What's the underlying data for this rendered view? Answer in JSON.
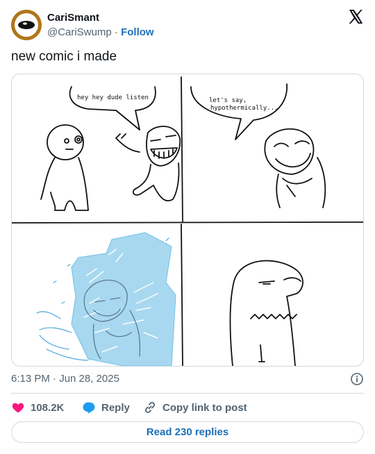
{
  "author": {
    "display_name": "CariSmant",
    "handle": "@CariSwump",
    "separator": "·",
    "follow_label": "Follow"
  },
  "tweet": {
    "text": "new comic i made"
  },
  "comic": {
    "panel1_speech": "hey hey dude  listen",
    "panel2_speech_line1": "let's say,",
    "panel2_speech_line2": "hypothermically..."
  },
  "meta": {
    "timestamp": "6:13 PM · Jun 28, 2025"
  },
  "actions": {
    "likes_count": "108.2K",
    "reply_label": "Reply",
    "copy_label": "Copy link to post"
  },
  "footer": {
    "read_replies_label": "Read 230 replies"
  },
  "colors": {
    "like_pink": "#f91880",
    "reply_blue": "#1d9bf0",
    "link_blue": "#1d6fb8",
    "ice_blue": "#a8d8f0"
  },
  "icons": [
    "x-logo-icon",
    "info-icon",
    "heart-icon",
    "speech-bubble-icon",
    "link-icon"
  ]
}
